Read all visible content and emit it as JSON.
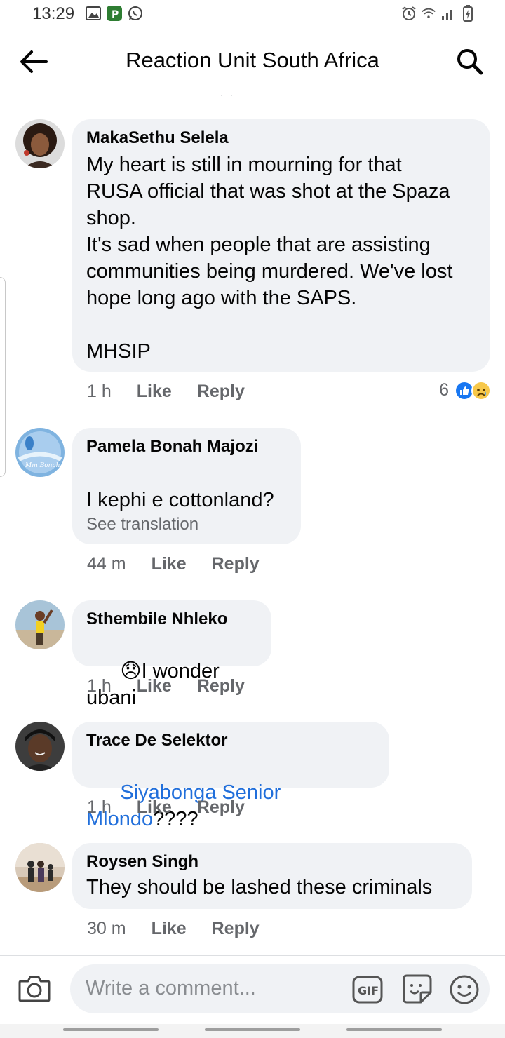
{
  "status_bar": {
    "time": "13:29",
    "left_icons": [
      "gallery-icon",
      "app-icon",
      "whatsapp-icon"
    ],
    "right_icons": [
      "alarm-icon",
      "wifi-icon",
      "signal-icon",
      "battery-icon"
    ]
  },
  "header": {
    "title": "Reaction Unit South Africa",
    "back_icon": "back-arrow-icon",
    "search_icon": "search-icon"
  },
  "comments": [
    {
      "author": "MakaSethu Selela",
      "text": "My heart is still in mourning for that\nRUSA official that was shot at the Spaza\nshop.\nIt's sad when people that are assisting\ncommunities being murdered. We've lost\nhope long ago with the SAPS.\n\nMHSIP",
      "time": "1 h",
      "like": "Like",
      "reply": "Reply",
      "reaction_count": "6",
      "reaction_icons": [
        "like-reaction-icon",
        "sad-reaction-icon"
      ]
    },
    {
      "author": "Pamela Bonah Majozi",
      "text": "\nI kephi e cottonland?",
      "see_translation": "See translation",
      "time": "44 m",
      "like": "Like",
      "reply": "Reply"
    },
    {
      "author": "Sthembile Nhleko",
      "emoji": "😞",
      "text": "I wonder ubani",
      "time": "1 h",
      "like": "Like",
      "reply": "Reply"
    },
    {
      "author": "Trace De Selektor",
      "mention": "Siyabonga Senior Mlondo",
      "text": "????",
      "time": "1 h",
      "like": "Like",
      "reply": "Reply"
    },
    {
      "author": "Roysen Singh",
      "text": "They should be lashed these criminals",
      "time": "30 m",
      "like": "Like",
      "reply": "Reply"
    }
  ],
  "composer": {
    "placeholder": "Write a comment...",
    "gif_label": "GIF",
    "icons": [
      "camera-icon",
      "gif-icon",
      "sticker-icon",
      "emoji-icon"
    ]
  },
  "colors": {
    "bubble": "#f0f2f5",
    "mention": "#216fdb",
    "meta": "#65676b",
    "like_blue": "#1877f2"
  }
}
